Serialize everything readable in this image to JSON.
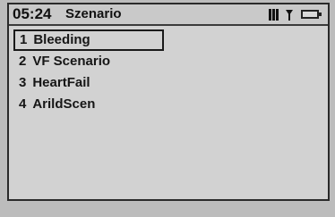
{
  "status_bar": {
    "time": "05:24",
    "title": "Szenario",
    "icons": [
      "signal-strength-icon",
      "antenna-icon",
      "battery-icon"
    ]
  },
  "menu": {
    "items": [
      {
        "number": "1",
        "label": "Bleeding",
        "selected": true
      },
      {
        "number": "2",
        "label": "VF Scenario",
        "selected": false
      },
      {
        "number": "3",
        "label": "HeartFail",
        "selected": false
      },
      {
        "number": "4",
        "label": "ArildScen",
        "selected": false
      }
    ]
  },
  "colors": {
    "screen_background": "#d2d2d2",
    "text": "#161616",
    "border": "#2a2a2a"
  }
}
